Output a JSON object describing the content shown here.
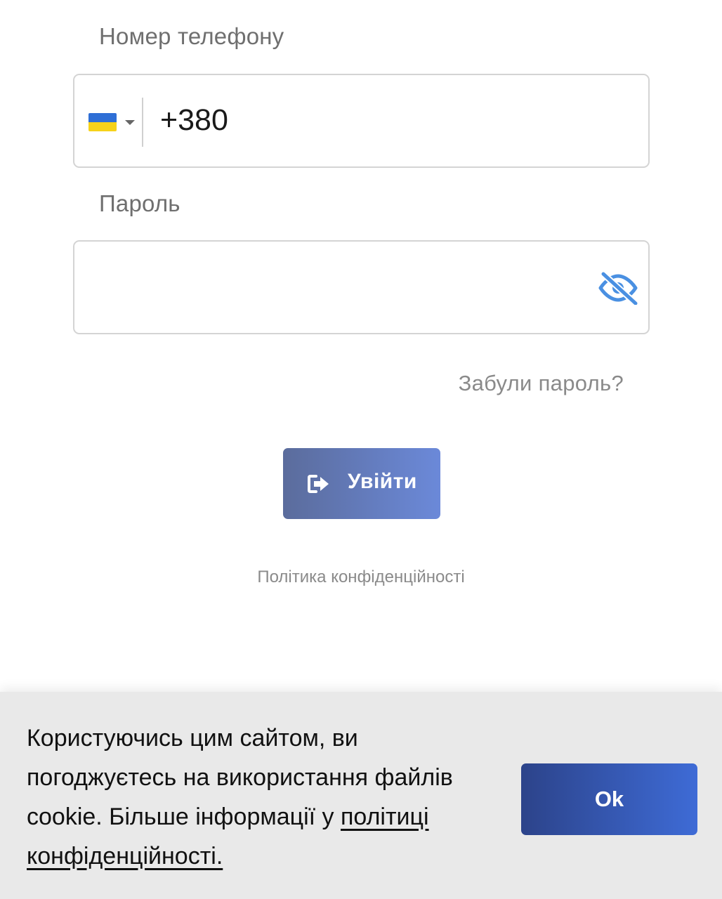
{
  "form": {
    "phone_label": "Номер телефону",
    "phone_value": "+380",
    "country_flag": "ukraine-flag-icon",
    "password_label": "Пароль",
    "password_value": "",
    "password_toggle_icon": "eye-slash-icon",
    "forgot_password": "Забули пароль?",
    "login_label": "Увійти",
    "login_icon": "sign-in-icon",
    "privacy_policy": "Політика конфіденційності"
  },
  "cookie_banner": {
    "text": "Користуючись цим сайтом, ви погоджуєтесь на використання файлів cookie. Більше інформації у ",
    "policy_link": "політиці конфіденційності.",
    "ok_label": "Ok"
  },
  "colors": {
    "accent": "#4a90e2",
    "login_button_start": "#5b6c9c",
    "login_button_end": "#6b89d9",
    "ok_button_start": "#2c438a",
    "ok_button_end": "#3e6bd6",
    "flag_blue": "#2f6fd6",
    "flag_yellow": "#f6d21a"
  }
}
